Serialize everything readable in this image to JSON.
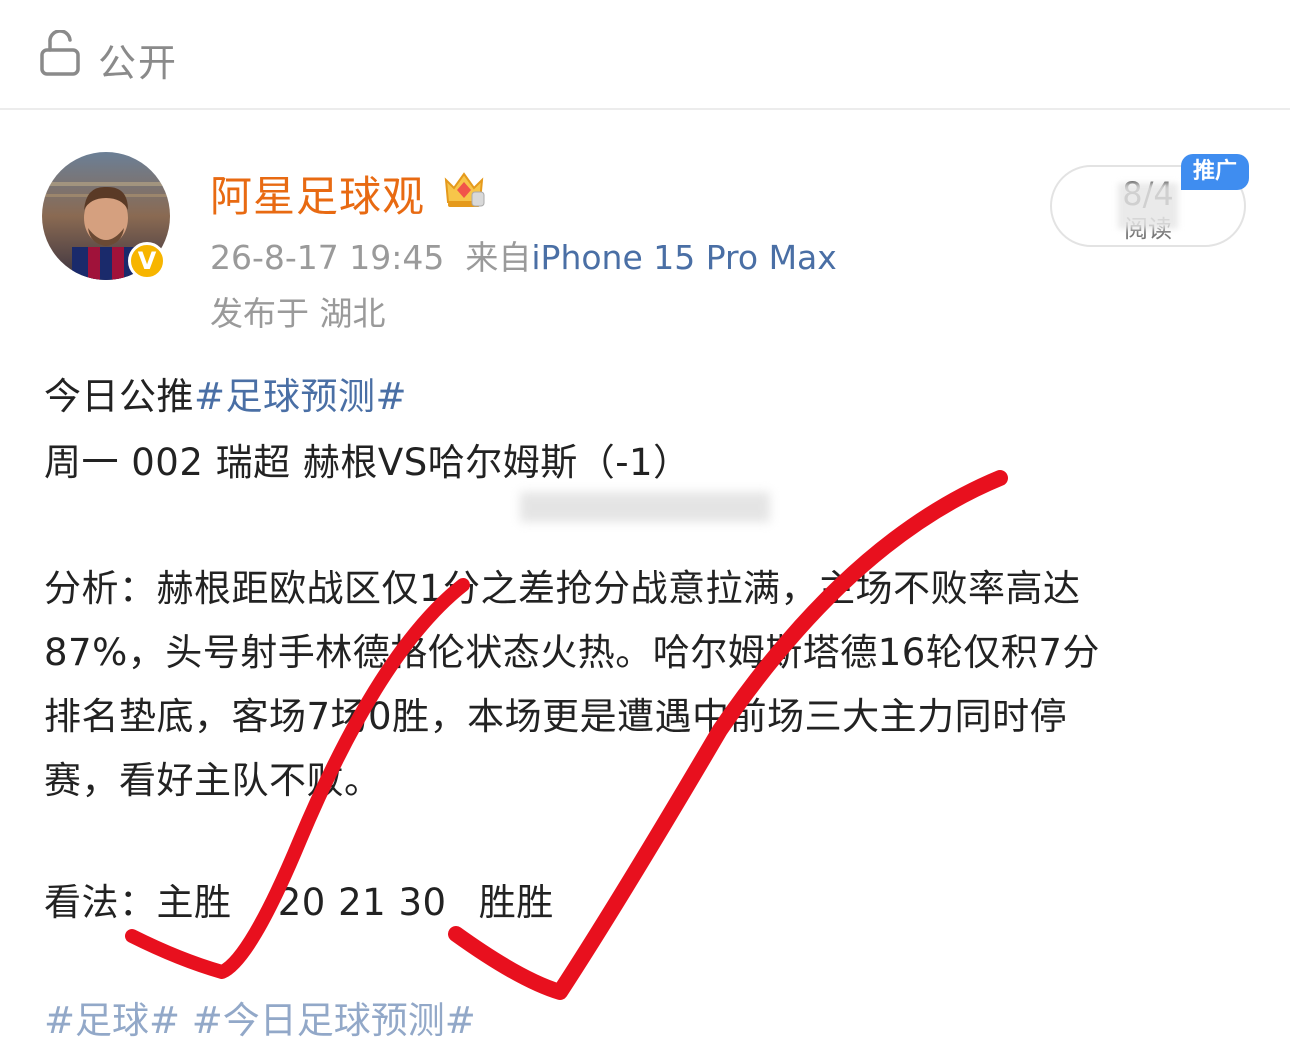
{
  "header": {
    "visibility_label": "公开",
    "icon": "lock-open-icon"
  },
  "author": {
    "name": "阿星足球观",
    "badge_icon": "crown-icon",
    "verified_icon": "verified-v-icon",
    "verified_text": "V",
    "timestamp": "26-8-17 19:45",
    "source_prefix": "来自",
    "device": "iPhone 15 Pro Max",
    "location": "发布于 湖北"
  },
  "promo": {
    "count": "8/4",
    "sub": "阅读",
    "tag": "推广"
  },
  "post": {
    "line1_prefix": "今日公推",
    "line1_hashtag": "#足球预测#",
    "line2": "周一 002 瑞超 赫根VS哈尔姆斯（-1）",
    "analysis_1": "分析：赫根距欧战区仅1分之差抢分战意拉满，主场不败率高达",
    "analysis_2": " 87%，头号射手林德格伦状态火热。哈尔姆斯塔德16轮仅积7分",
    "analysis_3": "排名垫底，客场7场0胜，本场更是遭遇中前场三大主力同时停",
    "analysis_4": "赛，看好主队不败。",
    "view_label": "看法：",
    "view_pick": "主胜",
    "view_scores": "20 21  30",
    "view_halffull": "胜胜",
    "bottom_tags": "#足球# #今日足球预测#"
  },
  "colors": {
    "username": "#e86a12",
    "link": "#4a6fa5",
    "checkmark": "#e8101e",
    "promo_tag": "#3f8df0"
  }
}
